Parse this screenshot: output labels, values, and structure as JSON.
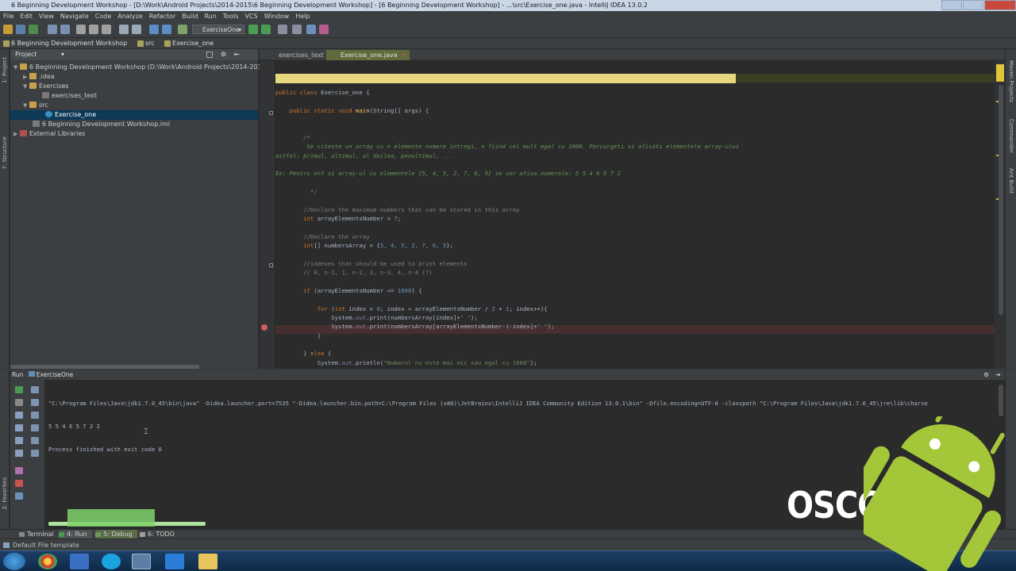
{
  "window": {
    "title": "6 Beginning Development Workshop - [D:\\Work\\Android Projects\\2014-2015\\6 Beginning Development Workshop] - [6 Beginning Development Workshop] - ...\\src\\Exercise_one.java - IntelliJ IDEA 13.0.2"
  },
  "menu": [
    "File",
    "Edit",
    "View",
    "Navigate",
    "Code",
    "Analyze",
    "Refactor",
    "Build",
    "Run",
    "Tools",
    "VCS",
    "Window",
    "Help"
  ],
  "toolbar": {
    "run_config": "ExerciseOne"
  },
  "breadcrumbs": [
    "6 Beginning Development Workshop",
    "src",
    "Exercise_one"
  ],
  "project": {
    "header": "Project",
    "items": [
      {
        "label": "6 Beginning Development Workshop (D:\\Work\\Android Projects\\2014-2015\\6 Beginn",
        "icon": "folder-icon"
      },
      {
        "label": ".idea",
        "icon": "folder-icon"
      },
      {
        "label": "Exercises",
        "icon": "folder-icon"
      },
      {
        "label": "exercises_text",
        "icon": "text-file-icon"
      },
      {
        "label": "src",
        "icon": "folder-icon"
      },
      {
        "label": "Exercise_one",
        "icon": "java-class-icon"
      },
      {
        "label": "6 Beginning Development Workshop.iml",
        "icon": "iml-file-icon"
      },
      {
        "label": "External Libraries",
        "icon": "library-icon"
      }
    ]
  },
  "editor": {
    "tabs": [
      "exercises_text",
      "Exercise_one.java"
    ],
    "lines": [
      {
        "parts": [
          [
            "kw",
            "public class "
          ],
          [
            "",
            "Exercise_one {"
          ]
        ]
      },
      {
        "parts": [
          [
            "kw",
            "    public static void "
          ],
          [
            "fn",
            "main"
          ],
          [
            "",
            "(String[] args) {"
          ]
        ]
      },
      {
        "parts": [
          [
            "dc",
            "        /*"
          ]
        ]
      },
      {
        "parts": [
          [
            "dc",
            "         Se citeste un array cu n elemente numere intregi, n fiind cel mult egal cu 1000. Parcurgeti si afisati elementele array-ului"
          ]
        ]
      },
      {
        "parts": [
          [
            "dc",
            "astfel: primul, ultimul, al doilea, penultimul, ..."
          ]
        ]
      },
      {
        "parts": [
          [
            "dc",
            "Ex: Pentru n=7 si array-ul cu elementele {5, 4, 5, 2, 7, 6, 5} se vor afisa numerele: 5 5 4 6 5 7 2"
          ]
        ]
      },
      {
        "parts": [
          [
            "dc",
            "          */"
          ]
        ]
      },
      {
        "parts": [
          [
            "cm",
            "        //Declare the maximum numbers that can be stored in this array"
          ]
        ]
      },
      {
        "parts": [
          [
            "kw",
            "        int "
          ],
          [
            "",
            "arrayElementsNumber = "
          ],
          [
            "nu",
            "7"
          ],
          [
            "",
            ";"
          ]
        ]
      },
      {
        "parts": [
          [
            "cm",
            "        //Declare the array"
          ]
        ]
      },
      {
        "parts": [
          [
            "kw",
            "        int"
          ],
          [
            "",
            "[] numbersArray = {"
          ],
          [
            "nu",
            "5, 4, 5, 2, 7, 6, 5"
          ],
          [
            "",
            "};"
          ]
        ]
      },
      {
        "parts": [
          [
            "cm",
            "        //indexes that should be used to print elements"
          ]
        ]
      },
      {
        "parts": [
          [
            "cm",
            "        // 0, n-1, 1, n-2, 3, n-3, 4, n-4 (?)"
          ]
        ]
      },
      {
        "parts": [
          [
            "kw",
            "        if "
          ],
          [
            "",
            "(arrayElementsNumber <= "
          ],
          [
            "nu",
            "1000"
          ],
          [
            "",
            ") {"
          ]
        ]
      },
      {
        "parts": [
          [
            "kw",
            "            for "
          ],
          [
            "",
            "("
          ],
          [
            "kw",
            "int "
          ],
          [
            "",
            "index = "
          ],
          [
            "nu",
            "0"
          ],
          [
            "",
            "; index < arrayElementsNumber / "
          ],
          [
            "nu",
            "2"
          ],
          [
            "",
            " + "
          ],
          [
            "nu",
            "1"
          ],
          [
            "",
            "; index++){"
          ]
        ]
      },
      {
        "parts": [
          [
            "",
            "                System."
          ],
          [
            "fl",
            "out"
          ],
          [
            "",
            ".print(numbersArray[index]+"
          ],
          [
            "st",
            "\" \""
          ],
          [
            "",
            ");"
          ]
        ]
      },
      {
        "parts": [
          [
            "",
            "                System."
          ],
          [
            "fl",
            "out"
          ],
          [
            "",
            ".print(numbersArray[arrayElementsNumber-"
          ],
          [
            "nu",
            "1"
          ],
          [
            "",
            "-index]+"
          ],
          [
            "st",
            "\" \""
          ],
          [
            "",
            ");"
          ]
        ]
      },
      {
        "parts": [
          [
            "",
            "            }"
          ]
        ]
      },
      {
        "parts": [
          [
            "",
            "        } "
          ],
          [
            "kw",
            "else "
          ],
          [
            "",
            "{"
          ]
        ]
      },
      {
        "parts": [
          [
            "",
            "            System."
          ],
          [
            "fl",
            "out"
          ],
          [
            "",
            ".println("
          ],
          [
            "st",
            "\"Numarul nu este mai mic sau egal cu 1000\""
          ],
          [
            "",
            ");"
          ]
        ]
      }
    ]
  },
  "run": {
    "header": "Run",
    "config": "ExerciseOne",
    "output": [
      "\"C:\\Program Files\\Java\\jdk1.7.0_45\\bin\\java\" -Didea.launcher.port=7535 \"-Didea.launcher.bin.path=C:\\Program Files (x86)\\JetBrains\\IntelliJ IDEA Community Edition 13.0.1\\bin\" -Dfile.encoding=UTF-8 -classpath \"C:\\Program Files\\Java\\jdk1.7.0_45\\jre\\lib\\charse",
      "5 5 4 6 5 7 2 2",
      "Process finished with exit code 0"
    ]
  },
  "bottom_tabs": {
    "terminal": "Terminal",
    "run": "4: Run",
    "debug": "5: Debug",
    "todo": "6: TODO"
  },
  "status": {
    "text": "Default File template"
  },
  "left_strip": {
    "structure": "7: Structure",
    "project": "1: Project",
    "favorites": "2: Favorites"
  },
  "right_strip": {
    "maven": "Maven Projects",
    "commander": "Commander",
    "ant": "Ant Build"
  },
  "watermark": {
    "text": "OSCCJ"
  }
}
